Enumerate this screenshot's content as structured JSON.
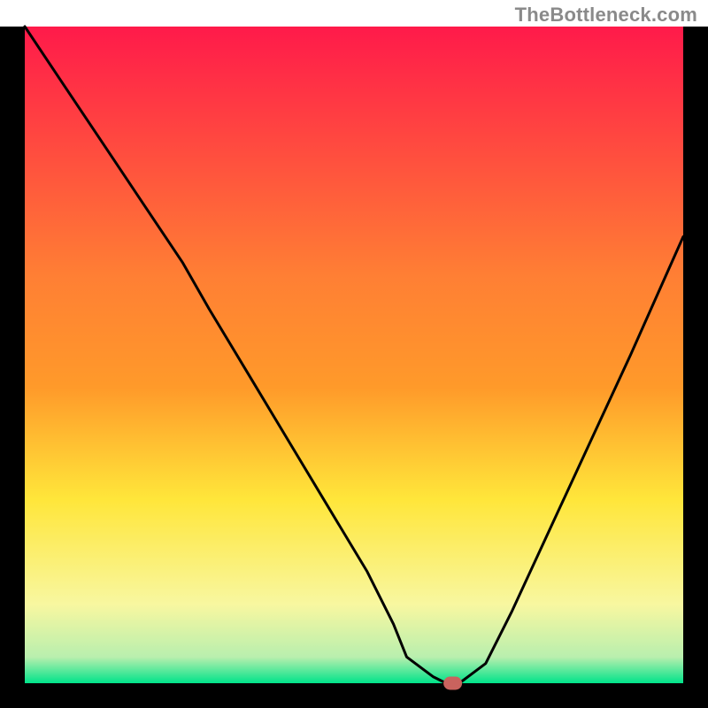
{
  "watermark": "TheBottleneck.com",
  "colors": {
    "frame": "#000000",
    "line": "#000000",
    "marker_fill": "#c9635e",
    "marker_stroke": "#c9635e",
    "gradient_top": "#ff1a4a",
    "gradient_mid1": "#ff9a2a",
    "gradient_mid2": "#ffe63a",
    "gradient_mid3": "#f8f7a0",
    "gradient_bottom": "#00e38a"
  },
  "chart_data": {
    "type": "line",
    "title": "",
    "xlabel": "",
    "ylabel": "",
    "xlim": [
      0,
      100
    ],
    "ylim": [
      0,
      100
    ],
    "x": [
      0,
      6,
      12,
      18,
      24,
      28,
      34,
      40,
      46,
      52,
      56,
      58,
      62,
      64,
      66,
      70,
      74,
      80,
      86,
      92,
      100
    ],
    "values": [
      100,
      91,
      82,
      73,
      64,
      57,
      47,
      37,
      27,
      17,
      9,
      4,
      1,
      0,
      0,
      3,
      11,
      24,
      37,
      50,
      68
    ],
    "marker": {
      "x": 65,
      "y": 0
    },
    "notes": "V-shaped bottleneck curve on vertical red→green gradient; minimum (optimal) near x≈65. Axes unlabeled; values approximate, read as percentages."
  }
}
